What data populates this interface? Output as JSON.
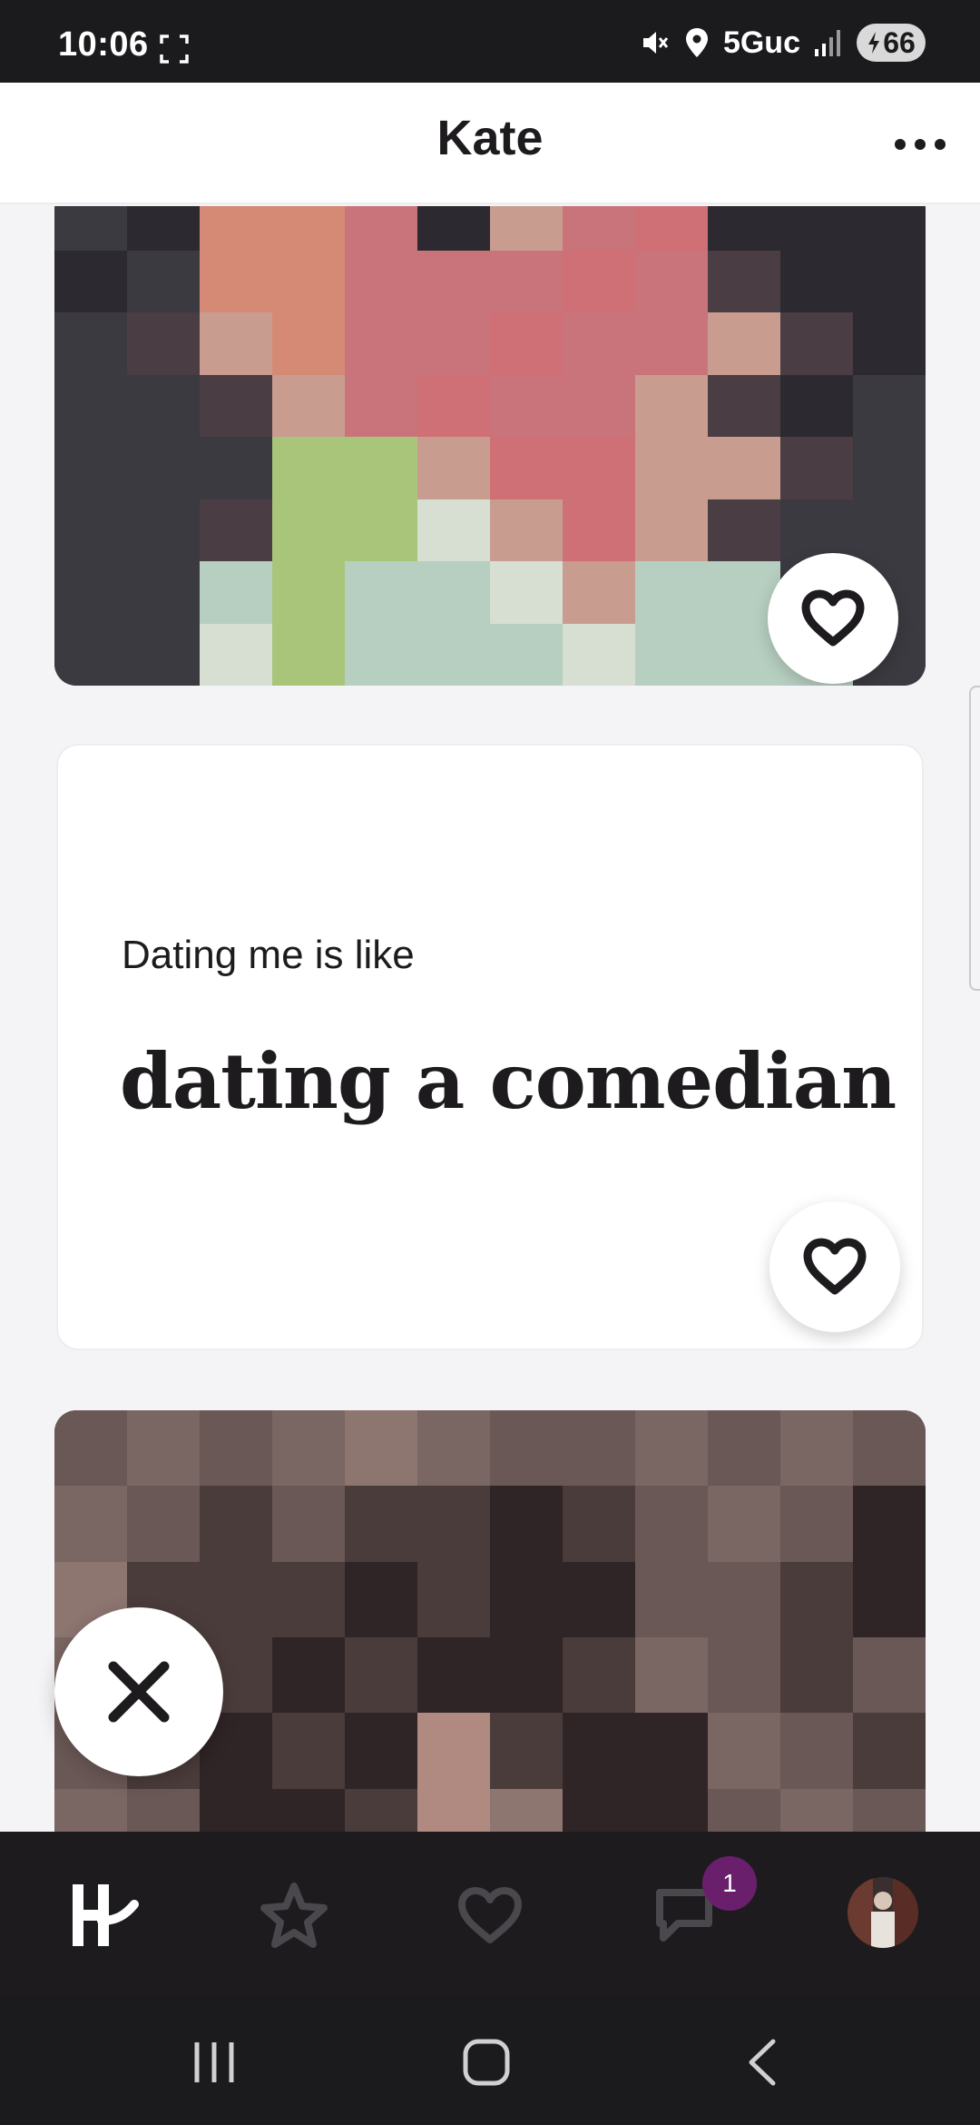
{
  "status_bar": {
    "time": "10:06",
    "network": "5Guc",
    "battery": "66",
    "icons": [
      "screenshot-icon",
      "mute-icon",
      "location-icon",
      "signal-icon",
      "battery-charging-icon"
    ]
  },
  "header": {
    "title": "Kate",
    "more_icon": "more-horizontal-icon"
  },
  "prompt": {
    "question": "Dating me is like",
    "answer": "dating a comedian"
  },
  "actions": {
    "like_icon": "heart-icon",
    "skip_icon": "x-icon"
  },
  "tabs": [
    {
      "name": "discover",
      "icon": "hinge-logo-icon",
      "active": true
    },
    {
      "name": "standouts",
      "icon": "star-icon",
      "active": false
    },
    {
      "name": "likes-you",
      "icon": "heart-icon",
      "active": false
    },
    {
      "name": "matches",
      "icon": "chat-icon",
      "active": false,
      "badge": "1"
    },
    {
      "name": "profile",
      "icon": "avatar",
      "active": false
    }
  ],
  "colors": {
    "accent": "#6a1f6c",
    "text": "#1d1b1e",
    "bar": "#1d1b1e",
    "inactive_icon": "#4a484c"
  }
}
